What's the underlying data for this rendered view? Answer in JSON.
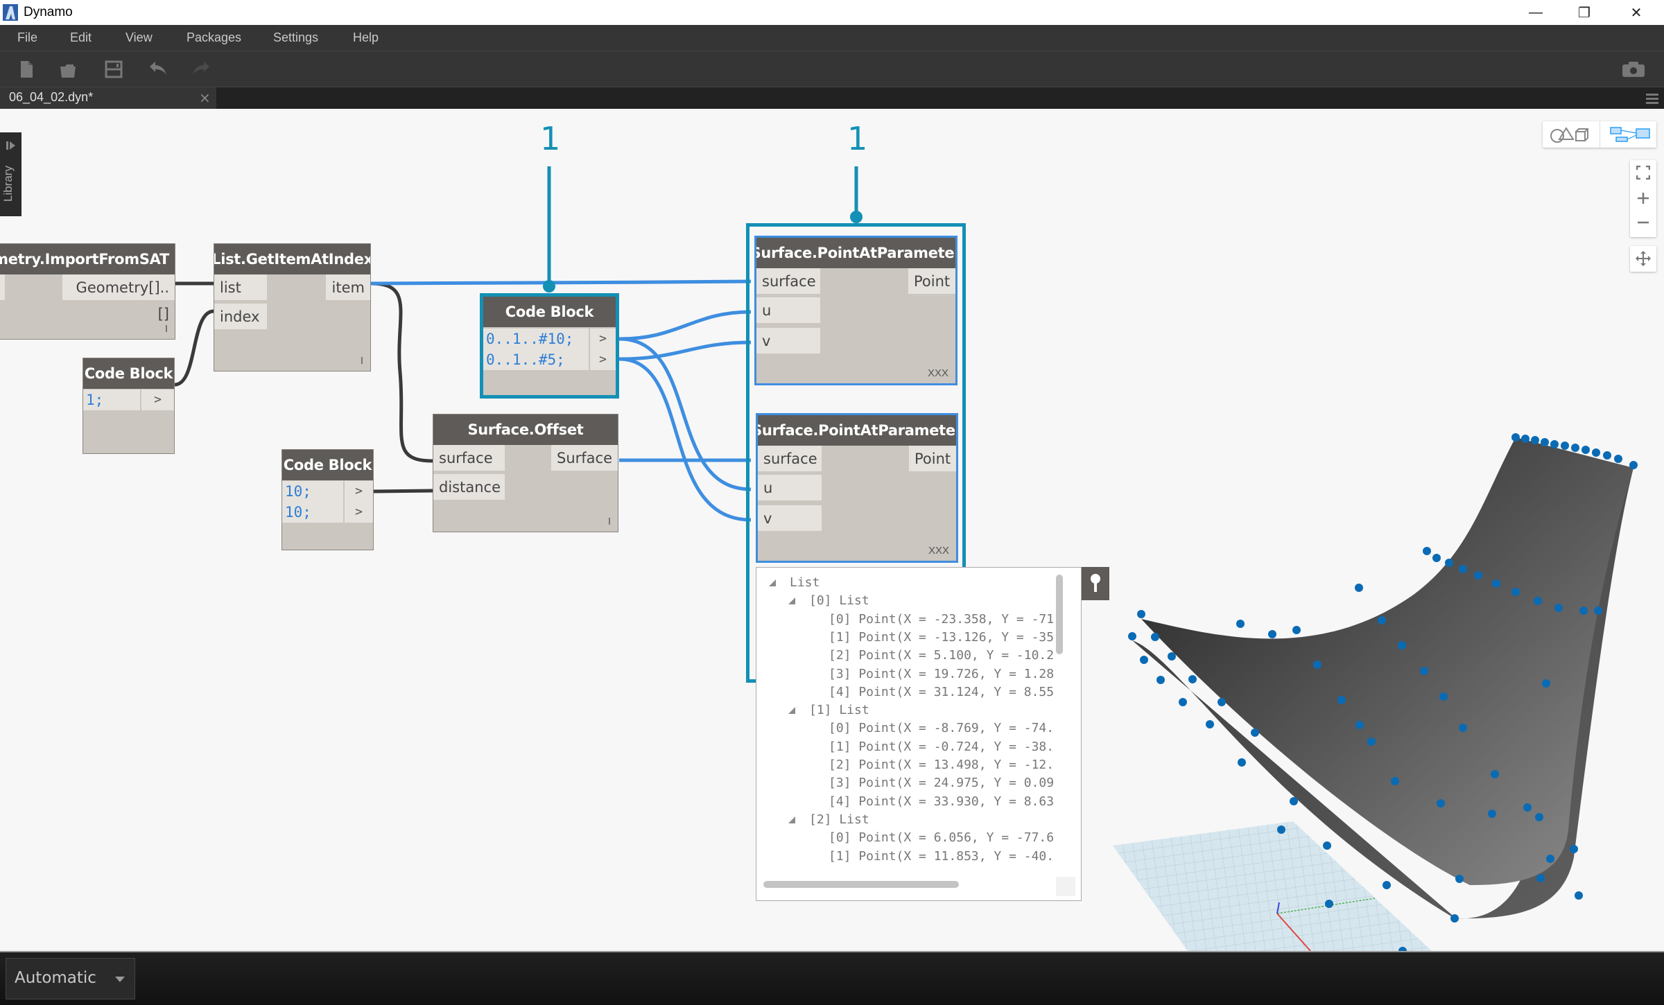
{
  "window": {
    "title": "Dynamo",
    "controls": {
      "minimize": "—",
      "restore": "❐",
      "close": "✕"
    }
  },
  "menu": [
    "File",
    "Edit",
    "View",
    "Packages",
    "Settings",
    "Help"
  ],
  "toolbar": {
    "icons": [
      "new-file-icon",
      "open-folder-icon",
      "save-icon",
      "undo-icon",
      "redo-icon"
    ],
    "right_icon": "camera-icon"
  },
  "tab": {
    "label": "06_04_02.dyn*",
    "close": "×"
  },
  "library": {
    "label": "Library"
  },
  "nodes": {
    "import_sat": {
      "title": "Geometry.ImportFromSAT",
      "output": "Geometry[]..[]",
      "lacing": "I"
    },
    "get_item": {
      "title": "List.GetItemAtIndex",
      "inputs": [
        "list",
        "index"
      ],
      "output": "item",
      "lacing": "I"
    },
    "code_block_index": {
      "title": "Code Block",
      "lines": [
        "1;"
      ],
      "out": ">"
    },
    "code_block_uv": {
      "title": "Code Block",
      "lines": [
        "0..1..#10;",
        "0..1..#5;"
      ],
      "out": ">"
    },
    "code_block_dist": {
      "title": "Code Block",
      "lines": [
        "10;",
        "10;"
      ],
      "out": ">"
    },
    "surface_offset": {
      "title": "Surface.Offset",
      "inputs": [
        "surface",
        "distance"
      ],
      "output": "Surface",
      "lacing": "I"
    },
    "point_at_param_1": {
      "title": "Surface.PointAtParameter",
      "inputs": [
        "surface",
        "u",
        "v"
      ],
      "output": "Point",
      "lacing": "XXX"
    },
    "point_at_param_2": {
      "title": "Surface.PointAtParameter",
      "inputs": [
        "surface",
        "u",
        "v"
      ],
      "output": "Point",
      "lacing": "XXX"
    }
  },
  "annotations": [
    "1",
    "1"
  ],
  "preview": {
    "rows": [
      {
        "level": 0,
        "tri": true,
        "text": "List"
      },
      {
        "level": 1,
        "tri": true,
        "text": "[0] List"
      },
      {
        "level": 2,
        "tri": false,
        "text": "[0] Point(X = -23.358, Y = -71"
      },
      {
        "level": 2,
        "tri": false,
        "text": "[1] Point(X = -13.126, Y = -35"
      },
      {
        "level": 2,
        "tri": false,
        "text": "[2] Point(X = 5.100, Y = -10.2"
      },
      {
        "level": 2,
        "tri": false,
        "text": "[3] Point(X = 19.726, Y = 1.28"
      },
      {
        "level": 2,
        "tri": false,
        "text": "[4] Point(X = 31.124, Y = 8.55"
      },
      {
        "level": 1,
        "tri": true,
        "text": "[1] List"
      },
      {
        "level": 2,
        "tri": false,
        "text": "[0] Point(X = -8.769, Y = -74."
      },
      {
        "level": 2,
        "tri": false,
        "text": "[1] Point(X = -0.724, Y = -38."
      },
      {
        "level": 2,
        "tri": false,
        "text": "[2] Point(X = 13.498, Y = -12."
      },
      {
        "level": 2,
        "tri": false,
        "text": "[3] Point(X = 24.975, Y = 0.09"
      },
      {
        "level": 2,
        "tri": false,
        "text": "[4] Point(X = 33.930, Y = 8.63"
      },
      {
        "level": 1,
        "tri": true,
        "text": "[2] List"
      },
      {
        "level": 2,
        "tri": false,
        "text": "[0] Point(X = 6.056, Y = -77.6"
      },
      {
        "level": 2,
        "tri": false,
        "text": "[1] Point(X = 11.853, Y = -40."
      }
    ]
  },
  "view_controls": {
    "toggle": [
      "geometry-view-icon",
      "graph-view-icon"
    ],
    "zoom": [
      "zoom-fit-icon",
      "zoom-in-icon",
      "zoom-out-icon"
    ],
    "pan": "pan-icon"
  },
  "run": {
    "mode": "Automatic"
  },
  "colors": {
    "accent": "#1390b5",
    "wire_active": "#3e8ee0",
    "wire_default": "#3a3a3a",
    "point": "#0a6bb5",
    "node_header": "#5e5b58",
    "node_body": "#cbc6bf"
  }
}
